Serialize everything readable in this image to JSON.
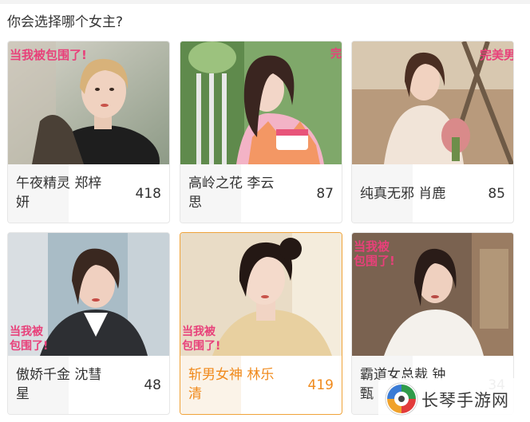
{
  "question": "你会选择哪个女主?",
  "poster_text": "当我被包围了!",
  "poster_text_2": "完美男女",
  "options": [
    {
      "name": "午夜精灵 郑梓妍",
      "votes": "418",
      "selected": false
    },
    {
      "name": "高岭之花 李云思",
      "votes": "87",
      "selected": false
    },
    {
      "name": "纯真无邪 肖鹿",
      "votes": "85",
      "selected": false
    },
    {
      "name": "傲娇千金 沈彗星",
      "votes": "48",
      "selected": false
    },
    {
      "name": "斩男女神 林乐清",
      "votes": "419",
      "selected": true
    },
    {
      "name": "霸道女总裁 钟甄",
      "votes": "34",
      "selected": false
    }
  ],
  "watermark": {
    "text": "长琴手游网"
  },
  "colors": {
    "accent": "#f08a1c",
    "selected_border": "#f0a33a",
    "text": "#333333"
  }
}
